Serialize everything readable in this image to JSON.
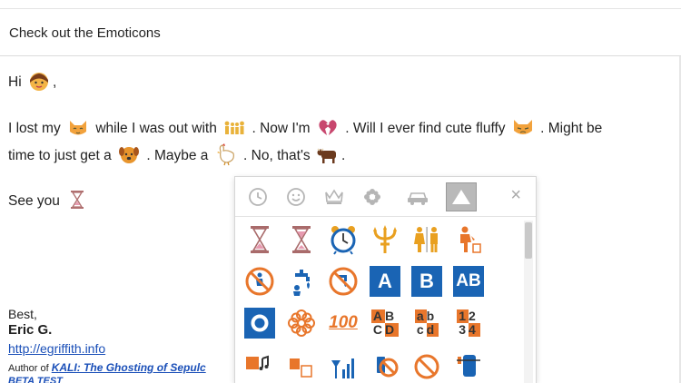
{
  "subject": "Check out the Emoticons",
  "body": {
    "greeting": "Hi",
    "greeting_end": ",",
    "line1_a": "I lost my",
    "line1_b": "while I was out with",
    "line1_c": ". Now I'm",
    "line1_d": ".  Will I ever find cute fluffy",
    "line1_e": ". Might be",
    "line2_a": "time to just get a",
    "line2_b": ".  Maybe a",
    "line2_c": ".  No, that's",
    "line2_d": ".",
    "line3": "See you"
  },
  "signature": {
    "closing": "Best,",
    "name": "Eric G.",
    "link": "http://egriffith.info",
    "author_prefix": "Author of",
    "book_title": "KALI: The Ghosting of Sepulc",
    "partial_line": "BETA TEST"
  },
  "picker": {
    "close_label": "×",
    "tabs": [
      "clock-icon",
      "smiley-icon",
      "crown-icon",
      "flower-icon",
      "car-icon",
      "triangle-icon"
    ],
    "active_tab": 5,
    "labels": {
      "a": "A",
      "b": "B",
      "ab": "AB",
      "hundred": "100",
      "abcd_1": "AB",
      "abcd_2": "CD",
      "abcd_lower_1": "ab",
      "abcd_lower_2": "cd",
      "num_1": "12",
      "num_2": "34"
    },
    "colors": {
      "accent_blue": "#1a64b4",
      "orange": "#e8762b",
      "gold": "#e9a020"
    }
  }
}
